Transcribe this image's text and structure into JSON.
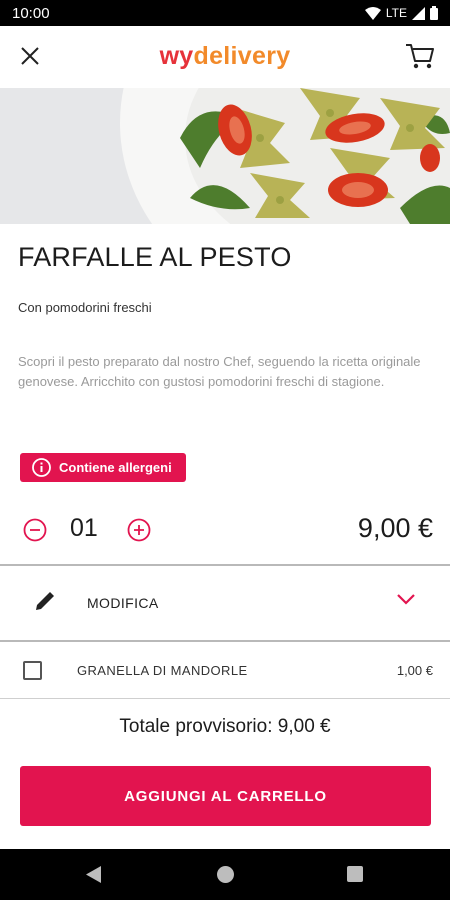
{
  "status_bar": {
    "time": "10:00",
    "network": "LTE"
  },
  "app_bar": {
    "logo_part1": "wy",
    "logo_part2": "delivery"
  },
  "product": {
    "name": "FARFALLE AL PESTO",
    "subtitle": "Con pomodorini freschi",
    "description": "Scopri il pesto preparato dal nostro Chef, seguendo la ricetta originale genovese. Arricchito con gustosi pomodorini freschi di stagione.",
    "allergen_label": "Contiene allergeni",
    "quantity": "01",
    "price": "9,00 €"
  },
  "modify": {
    "label": "MODIFICA"
  },
  "options": [
    {
      "label": "GRANELLA DI MANDORLE",
      "price": "1,00 €",
      "checked": false
    }
  ],
  "total": {
    "text": "Totale provvisorio: 9,00 €"
  },
  "add_button": {
    "label": "AGGIUNGI AL CARRELLO"
  },
  "colors": {
    "accent": "#e2144f",
    "logo_red": "#e6323a",
    "logo_orange": "#f28a2a"
  },
  "icons": {
    "close": "close-icon",
    "cart": "cart-icon",
    "info": "info-icon",
    "minus": "minus-circle-icon",
    "plus": "plus-circle-icon",
    "pencil": "pencil-icon",
    "chevron": "chevron-down-icon"
  }
}
